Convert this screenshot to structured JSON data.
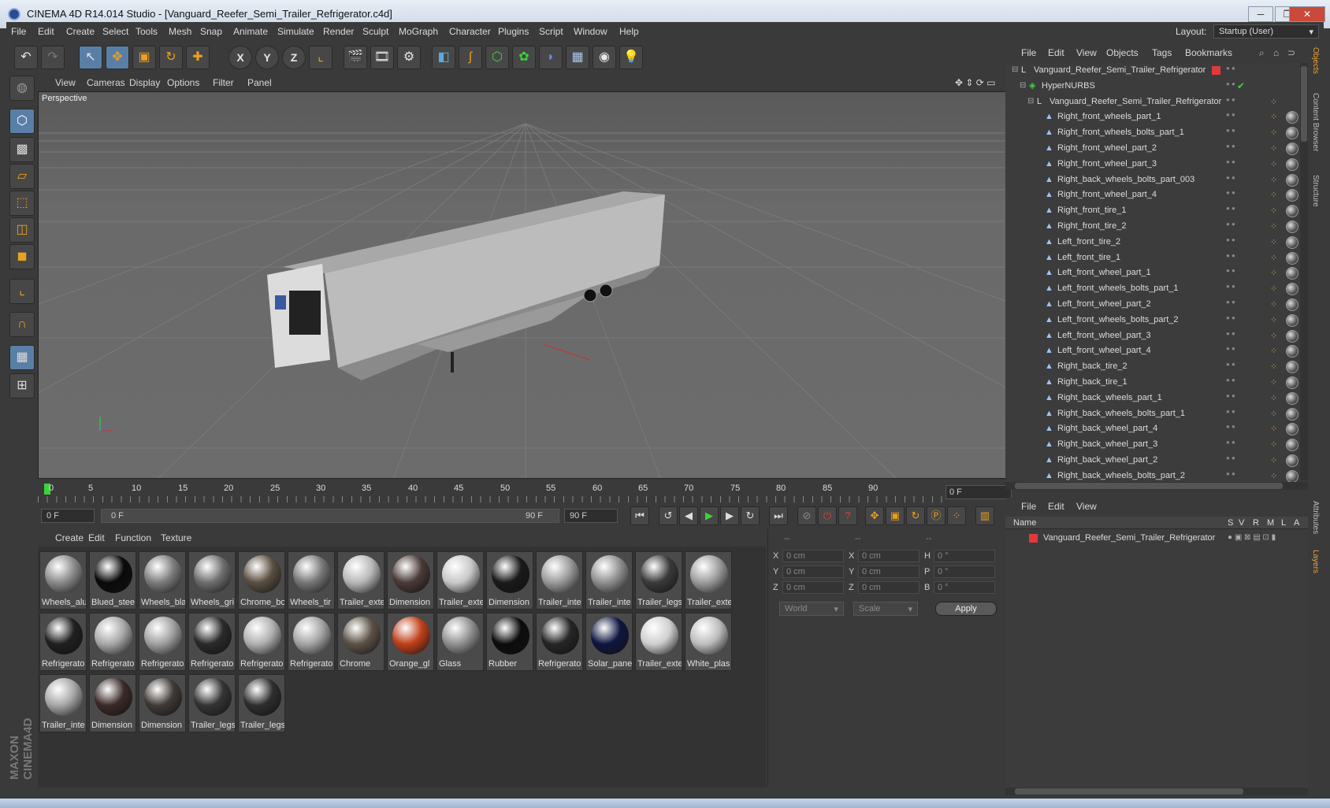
{
  "window": {
    "title": "CINEMA 4D R14.014 Studio - [Vanguard_Reefer_Semi_Trailer_Refrigerator.c4d]",
    "buttons": [
      "─",
      "❐",
      "✕"
    ]
  },
  "menubar": {
    "items": [
      "File",
      "Edit",
      "Create",
      "Select",
      "Tools",
      "Mesh",
      "Snap",
      "Animate",
      "Simulate",
      "Render",
      "Sculpt",
      "MoGraph",
      "Character",
      "Plugins",
      "Script",
      "Window",
      "Help"
    ],
    "layout_label": "Layout:",
    "layout_value": "Startup (User)"
  },
  "toolbar": {
    "icons": [
      "undo-icon",
      "redo-icon",
      "live-select-icon",
      "move-icon",
      "scale-icon",
      "rotate-icon",
      "add-object-icon",
      "x-axis-icon",
      "y-axis-icon",
      "z-axis-icon",
      "coordinate-system-icon",
      "render-view-icon",
      "render-picture-viewer-icon",
      "edit-render-settings-icon",
      "cube-primitive-icon",
      "spline-icon",
      "nurbs-icon",
      "array-icon",
      "deformer-icon",
      "floor-icon",
      "camera-icon",
      "light-icon"
    ],
    "axis_labels": [
      "X",
      "Y",
      "Z"
    ]
  },
  "leftbar": {
    "icons": [
      "make-editable-icon",
      "model-mode-icon",
      "texture-mode-icon",
      "workplane-icon",
      "points-mode-icon",
      "edges-mode-icon",
      "polygons-mode-icon",
      "axis-mode-icon",
      "magnet-icon",
      "snap-grid-icon",
      "lock-workplane-icon"
    ],
    "brand": "MAXON CINEMA4D"
  },
  "viewport": {
    "menu": [
      "View",
      "Cameras",
      "Display",
      "Options",
      "Filter",
      "Panel"
    ],
    "label": "Perspective"
  },
  "timeline": {
    "ticks": [
      "0",
      "5",
      "10",
      "15",
      "20",
      "25",
      "30",
      "35",
      "40",
      "45",
      "50",
      "55",
      "60",
      "65",
      "70",
      "75",
      "80",
      "85",
      "90"
    ],
    "current_frame": "0 F"
  },
  "transport": {
    "start_field": "0 F",
    "range_start": "0 F",
    "range_end": "90 F",
    "end_field": "90 F"
  },
  "materials": {
    "menu": [
      "Create",
      "Edit",
      "Function",
      "Texture"
    ],
    "items": [
      {
        "label": "Wheels_alu",
        "color": "#8a8a8a"
      },
      {
        "label": "Blued_stee",
        "color": "#0a0a0a"
      },
      {
        "label": "Wheels_bla",
        "color": "#7c7c7c"
      },
      {
        "label": "Wheels_gri",
        "color": "#6e6e6e"
      },
      {
        "label": "Chrome_bo",
        "color": "#5a4f40"
      },
      {
        "label": "Wheels_tir",
        "color": "#777777"
      },
      {
        "label": "Trailer_exte",
        "color": "#b8b8b8"
      },
      {
        "label": "Dimension",
        "color": "#4a3a36"
      },
      {
        "label": "Trailer_exte",
        "color": "#c8c8c8"
      },
      {
        "label": "Dimension",
        "color": "#1a1a1a"
      },
      {
        "label": "Trailer_inte",
        "color": "#9a9a9a"
      },
      {
        "label": "Trailer_inte",
        "color": "#8f8f8f"
      },
      {
        "label": "Trailer_legs",
        "color": "#3a3a3a"
      },
      {
        "label": "Trailer_exte",
        "color": "#9c9c9c"
      },
      {
        "label": "Refrigerato",
        "color": "#202020"
      },
      {
        "label": "Refrigerato",
        "color": "#a8a8a8"
      },
      {
        "label": "Refrigerato",
        "color": "#a0a0a0"
      },
      {
        "label": "Refrigerato",
        "color": "#2a2a2a"
      },
      {
        "label": "Refrigerato",
        "color": "#b0b0b0"
      },
      {
        "label": "Refrigerato",
        "color": "#a4a4a4"
      },
      {
        "label": "Chrome",
        "color": "#5c5246"
      },
      {
        "label": "Orange_gl",
        "color": "#c0401a"
      },
      {
        "label": "Glass",
        "color": "#909090"
      },
      {
        "label": "Rubber",
        "color": "#0c0c0c"
      },
      {
        "label": "Refrigerato",
        "color": "#262626"
      },
      {
        "label": "Solar_pane",
        "color": "#0e1640"
      },
      {
        "label": "Trailer_exte",
        "color": "#cfcfcf"
      },
      {
        "label": "White_plas",
        "color": "#bdbdbd"
      },
      {
        "label": "Trailer_inte",
        "color": "#a6a6a6"
      },
      {
        "label": "Dimension",
        "color": "#3a2a28"
      },
      {
        "label": "Dimension",
        "color": "#403a36"
      },
      {
        "label": "Trailer_legs",
        "color": "#343434"
      },
      {
        "label": "Trailer_legs",
        "color": "#2e2e2e"
      }
    ]
  },
  "coordinates": {
    "headers": [
      "--",
      "--",
      "--"
    ],
    "rows": [
      {
        "a": "X",
        "v1": "0 cm",
        "b": "X",
        "v2": "0 cm",
        "c": "H",
        "v3": "0 °"
      },
      {
        "a": "Y",
        "v1": "0 cm",
        "b": "Y",
        "v2": "0 cm",
        "c": "P",
        "v3": "0 °"
      },
      {
        "a": "Z",
        "v1": "0 cm",
        "b": "Z",
        "v2": "0 cm",
        "c": "B",
        "v3": "0 °"
      }
    ],
    "mode_select": "World",
    "type_select": "Scale",
    "apply": "Apply"
  },
  "objects": {
    "menu": [
      "File",
      "Edit",
      "View",
      "Objects",
      "Tags",
      "Bookmarks"
    ],
    "rows": [
      {
        "name": "Vanguard_Reefer_Semi_Trailer_Refrigerator",
        "level": 0,
        "icon": "null-object-icon"
      },
      {
        "name": "HyperNURBS",
        "level": 1,
        "icon": "hypernurbs-icon"
      },
      {
        "name": "Vanguard_Reefer_Semi_Trailer_Refrigerator",
        "level": 2,
        "icon": "null-object-icon"
      },
      {
        "name": "Right_front_wheels_part_1",
        "level": 3,
        "icon": "polygon-object-icon"
      },
      {
        "name": "Right_front_wheels_bolts_part_1",
        "level": 3,
        "icon": "polygon-object-icon"
      },
      {
        "name": "Right_front_wheel_part_2",
        "level": 3,
        "icon": "polygon-object-icon"
      },
      {
        "name": "Right_front_wheel_part_3",
        "level": 3,
        "icon": "polygon-object-icon"
      },
      {
        "name": "Right_back_wheels_bolts_part_003",
        "level": 3,
        "icon": "polygon-object-icon"
      },
      {
        "name": "Right_front_wheel_part_4",
        "level": 3,
        "icon": "polygon-object-icon"
      },
      {
        "name": "Right_front_tire_1",
        "level": 3,
        "icon": "polygon-object-icon"
      },
      {
        "name": "Right_front_tire_2",
        "level": 3,
        "icon": "polygon-object-icon"
      },
      {
        "name": "Left_front_tire_2",
        "level": 3,
        "icon": "polygon-object-icon"
      },
      {
        "name": "Left_front_tire_1",
        "level": 3,
        "icon": "polygon-object-icon"
      },
      {
        "name": "Left_front_wheel_part_1",
        "level": 3,
        "icon": "polygon-object-icon"
      },
      {
        "name": "Left_front_wheels_bolts_part_1",
        "level": 3,
        "icon": "polygon-object-icon"
      },
      {
        "name": "Left_front_wheel_part_2",
        "level": 3,
        "icon": "polygon-object-icon"
      },
      {
        "name": "Left_front_wheels_bolts_part_2",
        "level": 3,
        "icon": "polygon-object-icon"
      },
      {
        "name": "Left_front_wheel_part_3",
        "level": 3,
        "icon": "polygon-object-icon"
      },
      {
        "name": "Left_front_wheel_part_4",
        "level": 3,
        "icon": "polygon-object-icon"
      },
      {
        "name": "Right_back_tire_2",
        "level": 3,
        "icon": "polygon-object-icon"
      },
      {
        "name": "Right_back_tire_1",
        "level": 3,
        "icon": "polygon-object-icon"
      },
      {
        "name": "Right_back_wheels_part_1",
        "level": 3,
        "icon": "polygon-object-icon"
      },
      {
        "name": "Right_back_wheels_bolts_part_1",
        "level": 3,
        "icon": "polygon-object-icon"
      },
      {
        "name": "Right_back_wheel_part_4",
        "level": 3,
        "icon": "polygon-object-icon"
      },
      {
        "name": "Right_back_wheel_part_3",
        "level": 3,
        "icon": "polygon-object-icon"
      },
      {
        "name": "Right_back_wheel_part_2",
        "level": 3,
        "icon": "polygon-object-icon"
      },
      {
        "name": "Right_back_wheels_bolts_part_2",
        "level": 3,
        "icon": "polygon-object-icon"
      }
    ]
  },
  "layers": {
    "menu": [
      "File",
      "Edit",
      "View"
    ],
    "columns": [
      "Name",
      "S",
      "V",
      "R",
      "M",
      "L",
      "A"
    ],
    "rows": [
      {
        "name": "Vanguard_Reefer_Semi_Trailer_Refrigerator",
        "color": "#e03a3a"
      }
    ]
  },
  "sidetabs": [
    "Objects",
    "Content Browser",
    "Structure",
    "Attributes",
    "Layers"
  ],
  "colors": {
    "accent": "#5a7fa6",
    "icon_orange": "#eaa020",
    "layer_red": "#e03a3a",
    "play_green": "#3ad43a"
  }
}
